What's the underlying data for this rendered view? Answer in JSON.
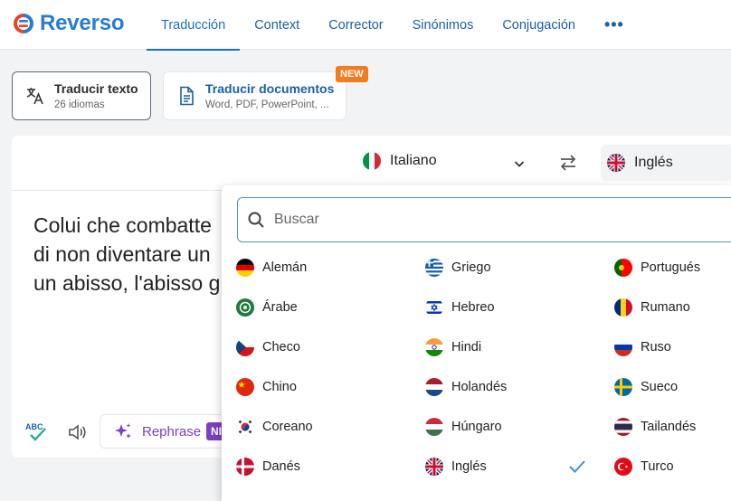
{
  "brand": {
    "name": "Reverso"
  },
  "nav": {
    "items": [
      "Traducción",
      "Context",
      "Corrector",
      "Sinónimos",
      "Conjugación"
    ],
    "more": "•••"
  },
  "modes": {
    "text": {
      "title": "Traducir texto",
      "subtitle": "26 idiomas"
    },
    "documents": {
      "title": "Traducir documentos",
      "subtitle": "Word, PDF, PowerPoint, ...",
      "badge": "NEW"
    }
  },
  "translator": {
    "source_language": "Italiano",
    "target_language": "Inglés",
    "source_text_lines": [
      "Colui che combatte",
      "di non diventare un",
      "un abisso, l'abisso g"
    ],
    "rephrase_label": "Rephrase",
    "rephrase_badge": "NI"
  },
  "dropdown": {
    "search_placeholder": "Buscar",
    "selected": "Inglés",
    "languages": [
      [
        "Alemán",
        "Griego",
        "Portugués"
      ],
      [
        "Árabe",
        "Hebreo",
        "Rumano"
      ],
      [
        "Checo",
        "Hindi",
        "Ruso"
      ],
      [
        "Chino",
        "Holandés",
        "Sueco"
      ],
      [
        "Coreano",
        "Húngaro",
        "Tailandés"
      ],
      [
        "Danés",
        "Inglés",
        "Turco"
      ]
    ]
  },
  "colors": {
    "brand_blue": "#2a7bd2",
    "nav_blue": "#1a5fa8",
    "accent_orange": "#f47b20",
    "rephrase_purple": "#7b3fc4"
  }
}
